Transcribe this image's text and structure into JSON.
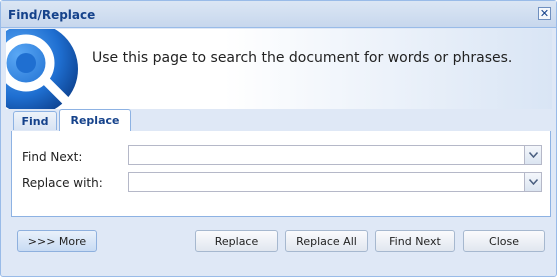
{
  "window": {
    "title": "Find/Replace",
    "close_symbol": "✕"
  },
  "header": {
    "intro_text": "Use this page to search the document for words or phrases."
  },
  "tabs": [
    {
      "label": "Find",
      "selected": false
    },
    {
      "label": "Replace",
      "selected": true
    }
  ],
  "form": {
    "find_next_label": "Find Next:",
    "find_next_value": "",
    "replace_with_label": "Replace with:",
    "replace_with_value": ""
  },
  "buttons": {
    "more": ">>> More",
    "replace": "Replace",
    "replace_all": "Replace All",
    "find_next": "Find Next",
    "close": "Close"
  },
  "colors": {
    "title_text": "#15428b",
    "dialog_bg": "#dfe8f6",
    "border": "#99bbe8",
    "logo_blue": "#1f6fd1"
  },
  "icons": {
    "logo": "app-logo-icon",
    "close": "close-icon",
    "dropdown": "chevron-down-icon"
  }
}
